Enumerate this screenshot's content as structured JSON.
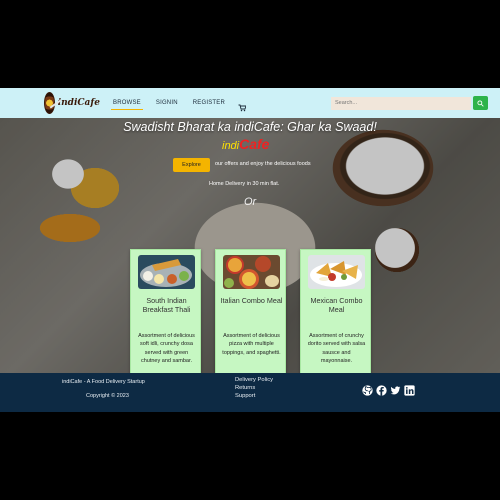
{
  "nav": {
    "brand": "indiCafe",
    "links": [
      {
        "label": "BROWSE",
        "active": true
      },
      {
        "label": "SIGNIN",
        "active": false
      },
      {
        "label": "REGISTER",
        "active": false
      }
    ],
    "cart_icon": "cart-icon",
    "search": {
      "placeholder": "Search...",
      "value": "",
      "button_icon": "search-icon"
    }
  },
  "hero": {
    "title": "Swadisht Bharat ka indiCafe: Ghar ka Swaad!",
    "brand_indi": "indi",
    "brand_cafe": "Cafe",
    "explore_label": "Explore",
    "explore_text": "our offers and enjoy the delicious foods",
    "delivery_text": "Home Delivery in 30 min flat.",
    "or_text": "Or"
  },
  "cards": [
    {
      "title": "South Indian Breakfast Thali",
      "description": "Assortment of delicious soft idli, crunchy dosa served with green chutney and sambar."
    },
    {
      "title": "Italian Combo Meal",
      "description": "Assortment of delicious pizza with multiple toppings, and spaghetti."
    },
    {
      "title": "Mexican Combo Meal",
      "description": "Assortment of crunchy dorito served with salsa sausce and mayonnaise."
    }
  ],
  "footer": {
    "company": "indiCafe - A Food Delivery Startup",
    "copyright": "Copyright © 2023",
    "links": [
      "Delivery Policy",
      "Returns",
      "Support"
    ],
    "social_icons": [
      "github-icon",
      "facebook-icon",
      "twitter-icon",
      "linkedin-icon"
    ]
  },
  "colors": {
    "navbar_bg": "#cdf1f7",
    "accent": "#f4b400",
    "search_button": "#2db34a",
    "card_bg": "#c6f7c2",
    "footer_bg": "#0d2a44",
    "brand_red": "#e22222"
  }
}
